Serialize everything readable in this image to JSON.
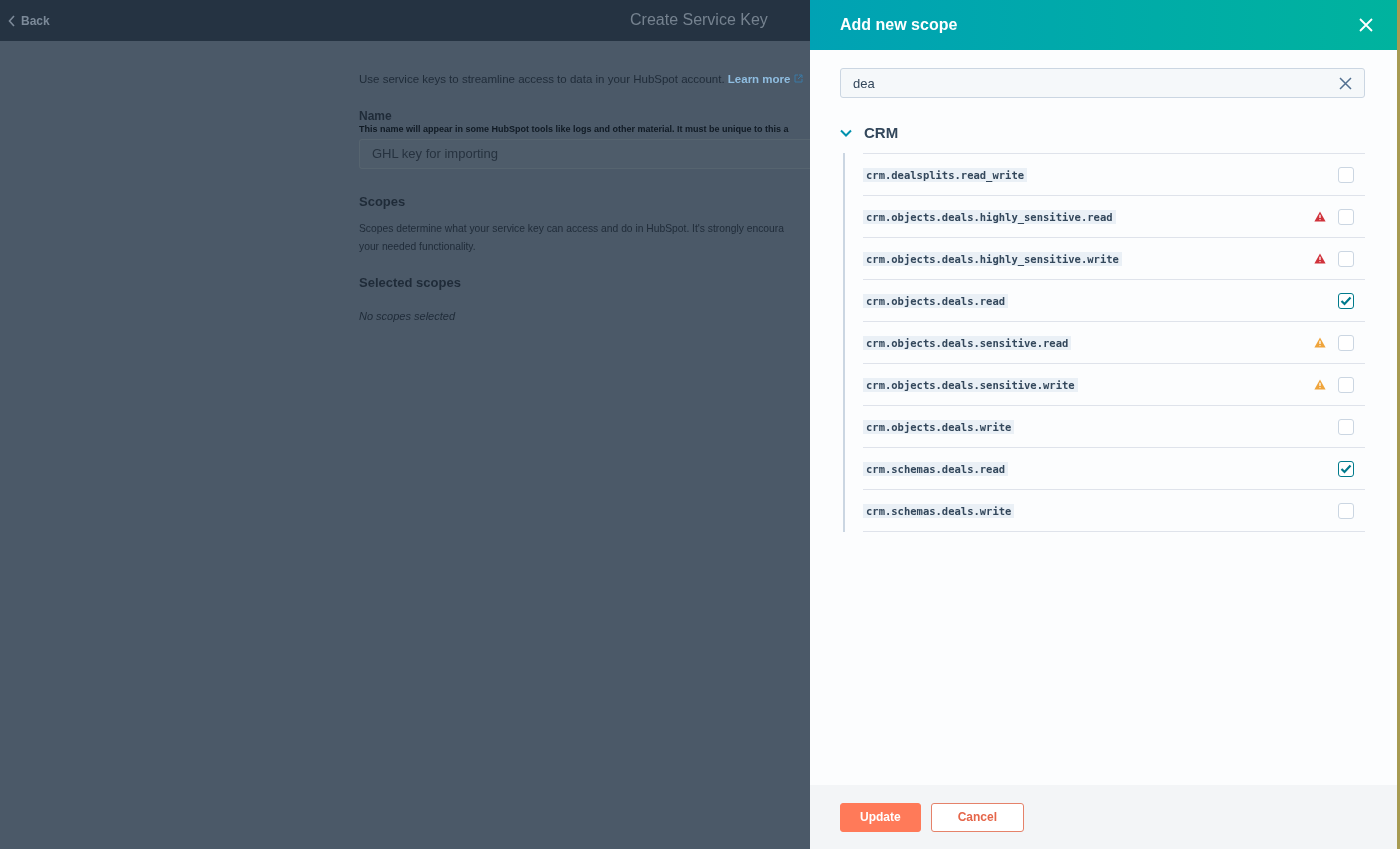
{
  "header": {
    "back": "Back",
    "title": "Create Service Key"
  },
  "page": {
    "intro": "Use service keys to streamline access to data in your HubSpot account.",
    "learn_more": "Learn more",
    "name_label": "Name",
    "name_help": "This name will appear in some HubSpot tools like logs and other material. It must be unique to this a",
    "name_value": "GHL key for importing",
    "scopes_title": "Scopes",
    "scopes_text_1": "Scopes determine what your service key can access and do in HubSpot. It's strongly encoura",
    "scopes_text_2": "your needed functionality.",
    "selected_title": "Selected scopes",
    "selected_empty": "No scopes selected"
  },
  "panel": {
    "title": "Add new scope",
    "search": {
      "value": "dea"
    },
    "group": {
      "label": "CRM",
      "expanded": true,
      "scopes": [
        {
          "name": "crm.dealsplits.read_write",
          "checked": false
        },
        {
          "name": "crm.objects.deals.highly_sensitive.read",
          "checked": false,
          "color": "#d0323b"
        },
        {
          "name": "crm.objects.deals.highly_sensitive.write",
          "checked": false,
          "color": "#d0323b"
        },
        {
          "name": "crm.objects.deals.read",
          "checked": true
        },
        {
          "name": "crm.objects.deals.sensitive.read",
          "checked": false,
          "color": "#efa43b"
        },
        {
          "name": "crm.objects.deals.sensitive.write",
          "checked": false,
          "color": "#efa43b"
        },
        {
          "name": "crm.objects.deals.write",
          "checked": false
        },
        {
          "name": "crm.schemas.deals.read",
          "checked": true
        },
        {
          "name": "crm.schemas.deals.write",
          "checked": false
        }
      ]
    },
    "buttons": [
      {
        "label": "Update",
        "kind": "primary"
      },
      {
        "label": "Cancel",
        "kind": "secondary"
      }
    ]
  }
}
